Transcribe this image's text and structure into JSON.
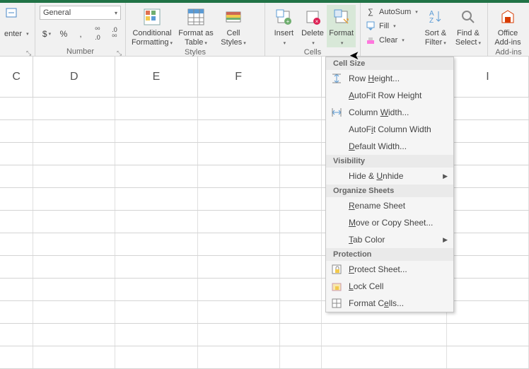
{
  "ribbon": {
    "alignment": {
      "label": "enter"
    },
    "number": {
      "combo": "General",
      "btn_dollar": "$",
      "btn_percent": "%",
      "btn_comma": ",",
      "btn_dec_inc": ".0◦",
      "btn_dec_dec": "◦.0",
      "group_label": "Number"
    },
    "styles": {
      "conditional": "Conditional\nFormatting",
      "format_table": "Format as\nTable",
      "cell_styles": "Cell\nStyles",
      "group_label": "Styles"
    },
    "cells": {
      "insert": "Insert",
      "delete": "Delete",
      "format": "Format",
      "group_label": "Cells"
    },
    "editing": {
      "autosum": "AutoSum",
      "fill": "Fill",
      "clear": "Clear",
      "sort": "Sort &\nFilter",
      "find": "Find &\nSelect"
    },
    "addins": {
      "office": "Office\nAdd-ins",
      "group_label": "Add-ins"
    }
  },
  "columns": [
    "C",
    "D",
    "E",
    "F",
    "",
    "",
    "I"
  ],
  "menu": {
    "h1": "Cell Size",
    "row_height": "Row Height...",
    "autofit_row": "AutoFit Row Height",
    "col_width": "Column Width...",
    "autofit_col": "AutoFit Column Width",
    "default_width": "Default Width...",
    "h2": "Visibility",
    "hide_unhide": "Hide & Unhide",
    "h3": "Organize Sheets",
    "rename": "Rename Sheet",
    "move_copy": "Move or Copy Sheet...",
    "tab_color": "Tab Color",
    "h4": "Protection",
    "protect": "Protect Sheet...",
    "lock": "Lock Cell",
    "format_cells": "Format Cells..."
  }
}
